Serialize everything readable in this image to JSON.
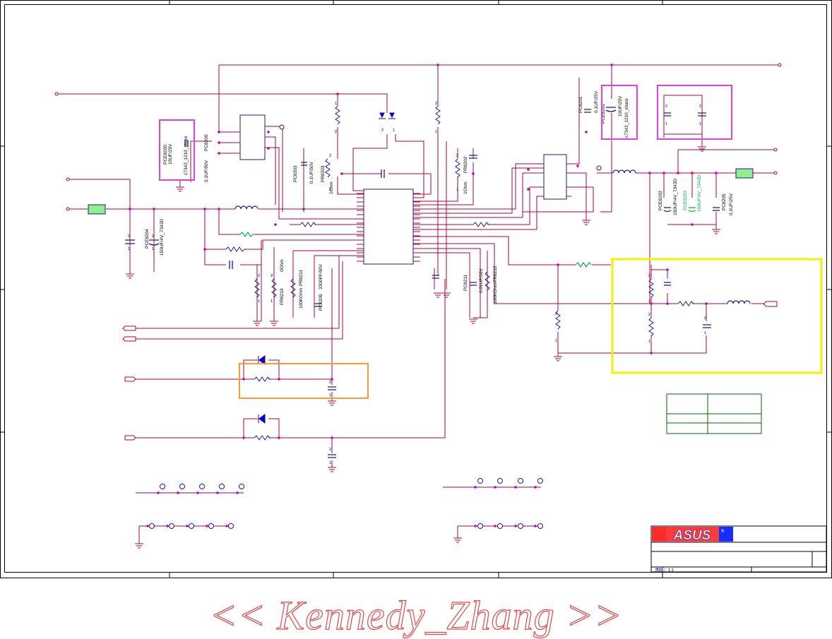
{
  "schematic": {
    "refdes": [
      "PCE8200",
      "PCE8201",
      "PCE8202",
      "PCE8203",
      "PCE8204",
      "PC8200",
      "PC8201",
      "PC8203",
      "PC8205",
      "PC8209",
      "PC8211",
      "PR8202",
      "PR8203",
      "PR8210",
      "PR8211",
      "PR8212"
    ],
    "values": [
      "10UF/25V",
      "c7343_1210_share",
      "0.1UF/50V",
      "0.1UF/25V",
      "150UF/4V_7343D",
      "1Ohm",
      "0Ohm",
      "100KOhm",
      "3300PF/50V",
      "0.01UF/50V"
    ],
    "pin_labels": [
      "1",
      "2"
    ]
  },
  "title_block": {
    "logo_text": "ASUS",
    "registered_mark": "®",
    "sheet_note": "图纸：1:1"
  },
  "watermark": "<< Kennedy_Zhang >>",
  "colors": {
    "wire": "#b0003a",
    "part": "#1a1a8c",
    "junction": "#c000c0",
    "pin": "#b0003a",
    "highlight_magenta": "#e040e0",
    "highlight_yellow": "#f0f000",
    "highlight_orange": "#ff9933",
    "port_fill": "#90ee90",
    "green_part": "#00c000",
    "diode": "#0000cc",
    "frame": "#000000",
    "watermark": "#e04848"
  }
}
